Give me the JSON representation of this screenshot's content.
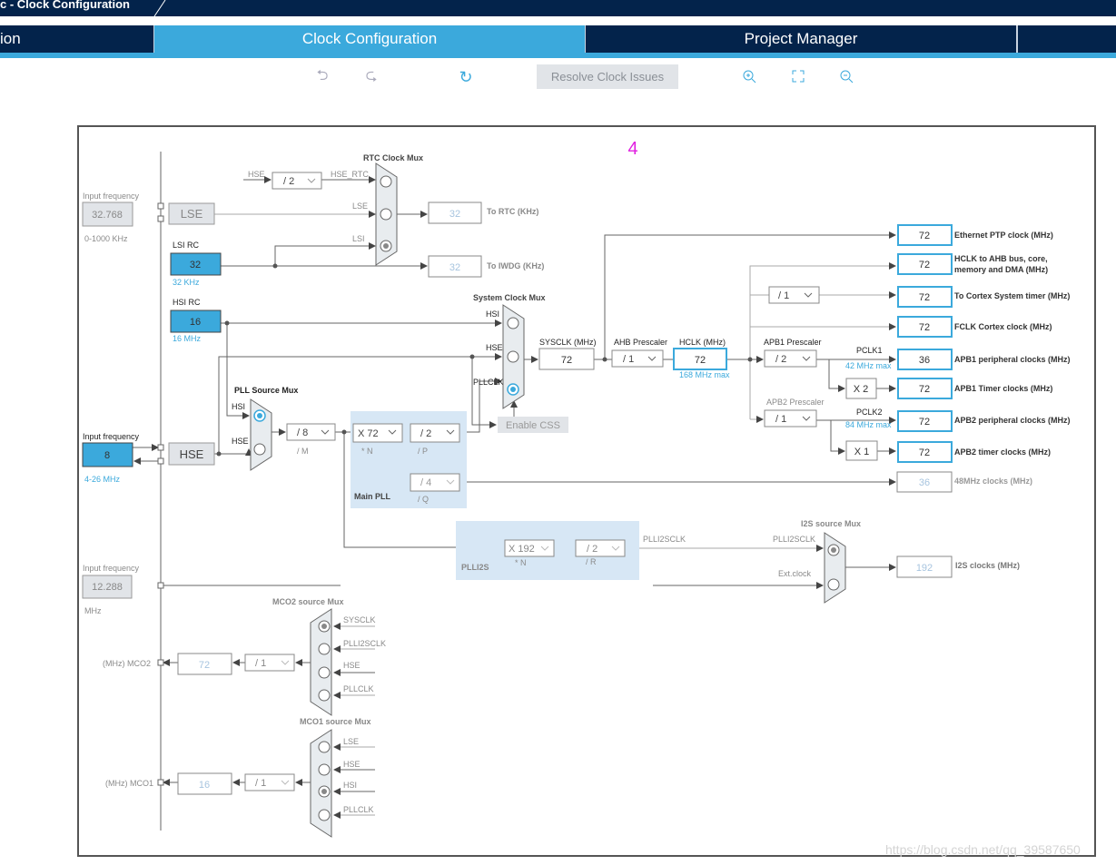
{
  "header": {
    "title": "c - Clock Configuration"
  },
  "tabs": [
    {
      "label": "ion"
    },
    {
      "label": "Clock Configuration",
      "active": true
    },
    {
      "label": "Project Manager"
    }
  ],
  "toolbar": {
    "undo": "undo-icon",
    "redo": "redo-icon",
    "refresh": "refresh-icon",
    "resolve_label": "Resolve Clock Issues",
    "zoom_in": "zoom-in-icon",
    "fit": "fit-icon",
    "zoom_out": "zoom-out-icon"
  },
  "annotation": "4",
  "colors": {
    "navy": "#03234b",
    "accent": "#3ba9dc",
    "annotation": "#e020e0"
  },
  "inputs": {
    "lse": {
      "label": "Input frequency",
      "value": "32.768",
      "range": "0-1000 KHz",
      "name": "LSE"
    },
    "lsi": {
      "label": "LSI RC",
      "value": "32",
      "unit": "32 KHz"
    },
    "hsi": {
      "label": "HSI RC",
      "value": "16",
      "unit": "16 MHz"
    },
    "hse": {
      "label": "Input frequency",
      "value": "8",
      "range": "4-26 MHz",
      "name": "HSE"
    },
    "ext": {
      "label": "Input frequency",
      "value": "12.288",
      "unit": "MHz"
    }
  },
  "rtc": {
    "title": "RTC Clock Mux",
    "hse_in": "HSE",
    "div": "/ 2",
    "hse_rtc": "HSE_RTC",
    "lse": "LSE",
    "lsi": "LSI",
    "rtc_value": "32",
    "rtc_label": "To RTC (KHz)",
    "iwdg_value": "32",
    "iwdg_label": "To IWDG (KHz)"
  },
  "sysmux": {
    "title": "System Clock Mux",
    "hsi": "HSI",
    "hse": "HSE",
    "pllclk": "PLLCLK",
    "selected": "PLLCLK",
    "css": "Enable CSS"
  },
  "pllmux": {
    "title": "PLL Source Mux",
    "hsi": "HSI",
    "hse": "HSE",
    "selected": "HSI"
  },
  "pll": {
    "title": "Main PLL",
    "m": "/ 8",
    "m_label": "/ M",
    "n": "X 72",
    "n_label": "* N",
    "p": "/ 2",
    "p_label": "/ P",
    "q": "/ 4",
    "q_label": "/ Q"
  },
  "bus": {
    "sysclk_label": "SYSCLK (MHz)",
    "sysclk": "72",
    "ahb_label": "AHB Prescaler",
    "ahb": "/ 1",
    "hclk_label": "HCLK (MHz)",
    "hclk": "72",
    "hclk_max": "168 MHz max",
    "cortex_div": "/ 1",
    "apb1_label": "APB1 Prescaler",
    "apb1": "/ 2",
    "pclk1": "PCLK1",
    "pclk1_max": "42 MHz max",
    "x2": "X 2",
    "apb2_label": "APB2 Prescaler",
    "apb2": "/ 1",
    "pclk2": "PCLK2",
    "pclk2_max": "84 MHz max",
    "x1": "X 1"
  },
  "outputs": [
    {
      "value": "72",
      "label": "Ethernet PTP clock (MHz)"
    },
    {
      "value": "72",
      "label": "HCLK to AHB bus, core,",
      "label2": "memory and DMA (MHz)"
    },
    {
      "value": "72",
      "label": "To Cortex System timer (MHz)"
    },
    {
      "value": "72",
      "label": "FCLK Cortex clock (MHz)"
    },
    {
      "value": "36",
      "label": "APB1 peripheral clocks (MHz)"
    },
    {
      "value": "72",
      "label": "APB1 Timer clocks (MHz)"
    },
    {
      "value": "72",
      "label": "APB2 peripheral clocks (MHz)"
    },
    {
      "value": "72",
      "label": "APB2 timer clocks (MHz)"
    },
    {
      "value": "36",
      "label": "48MHz clocks (MHz)"
    }
  ],
  "plli2s": {
    "title": "PLLI2S",
    "n": "X 192",
    "n_label": "* N",
    "r": "/ 2",
    "r_label": "/ R",
    "out": "PLLI2SCLK"
  },
  "i2smux": {
    "title": "I2S source Mux",
    "in1": "PLLI2SCLK",
    "in2": "Ext.clock",
    "value": "192",
    "label": "I2S clocks (MHz)",
    "selected": "PLLI2SCLK"
  },
  "mco2": {
    "title": "MCO2 source Mux",
    "inputs": [
      "SYSCLK",
      "PLLI2SCLK",
      "HSE",
      "PLLCLK"
    ],
    "selected": "SYSCLK",
    "div": "/ 1",
    "value": "72",
    "label": "(MHz) MCO2"
  },
  "mco1": {
    "title": "MCO1 source Mux",
    "inputs": [
      "LSE",
      "HSE",
      "HSI",
      "PLLCLK"
    ],
    "selected": "HSI",
    "div": "/ 1",
    "value": "16",
    "label": "(MHz) MCO1"
  },
  "watermark": "https://blog.csdn.net/qq_39587650"
}
